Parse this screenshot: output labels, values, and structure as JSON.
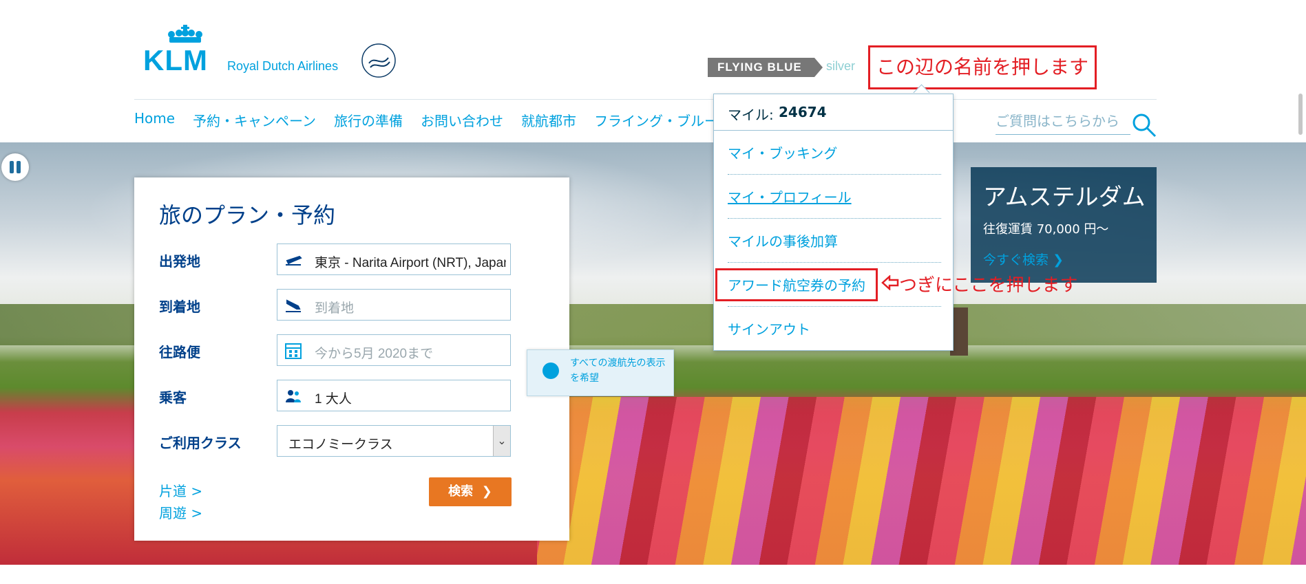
{
  "header": {
    "logo_text": "KLM",
    "logo_subtitle": "Royal Dutch Airlines",
    "skyteam_label": "SKYTEAM",
    "flying_blue_label": "FLYING BLUE",
    "tier_label": "silver",
    "annotation_name": "この辺の名前を押します"
  },
  "nav": {
    "items": [
      "Home",
      "予約・キャンペーン",
      "旅行の準備",
      "お問い合わせ",
      "就航都市",
      "フライング・ブルー"
    ],
    "search_placeholder": "ご質問はこちらから"
  },
  "booking": {
    "title": "旅のプラン・予約",
    "all_destinations": "すべての渡航先の表示を希望",
    "origin_label": "出発地",
    "origin_value": "東京 - Narita Airport (NRT), Japan",
    "destination_label": "到着地",
    "destination_placeholder": "到着地",
    "dates_label": "往路便",
    "dates_placeholder": "今から5月 2020まで",
    "passengers_label": "乗客",
    "passengers_value": "1 大人",
    "class_label": "ご利用クラス",
    "class_value": "エコノミークラス",
    "one_way_link": "片道 >",
    "multi_city_link": "周遊 >",
    "search_button": "検索"
  },
  "account_menu": {
    "miles_label": "マイル:",
    "miles_value": "24674",
    "items": [
      "マイ・ブッキング",
      "マイ・プロフィール",
      "マイルの事後加算",
      "アワード航空券の予約",
      "サインアウト"
    ],
    "annotation_next": "つぎにここを押します"
  },
  "promo": {
    "city": "アムステルダム",
    "fare": "往復運賃 70,000 円～",
    "cta": "今すぐ検索"
  },
  "colors": {
    "brand_blue": "#00a1de",
    "dark_blue": "#00408a",
    "cta_orange": "#e87722",
    "annotation_red": "#e31e24"
  }
}
